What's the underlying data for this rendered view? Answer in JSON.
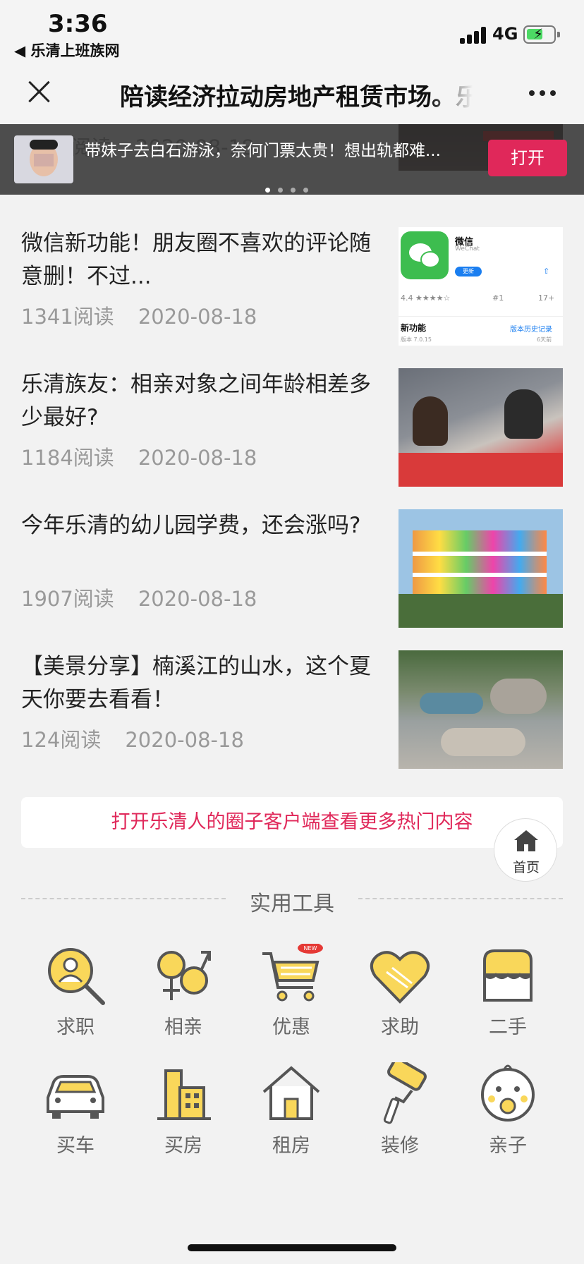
{
  "status_bar": {
    "time": "3:36",
    "back_app": "◀ 乐清上班族网",
    "network": "4G"
  },
  "nav": {
    "title": "陪读经济拉动房地产租赁市场。乐"
  },
  "banner": {
    "text": "带妹子去白石游泳，奈何门票太贵！想出轨都难...",
    "open_label": "打开",
    "partial_top_text": "毒！",
    "partial_read": "阅读",
    "partial_date": "2020-08-18"
  },
  "articles": [
    {
      "title": "微信新功能！朋友圈不喜欢的评论随意删！不过...",
      "reads": "1341阅读",
      "date": "2020-08-18",
      "thumb": {
        "app_name": "微信",
        "app_sub": "WeChat",
        "update": "更新",
        "rating": "4.4 ★★★★☆",
        "rank": "#1",
        "age": "17+",
        "new_features": "新功能",
        "history": "版本历史记录",
        "version": "版本 7.0.15",
        "days": "6天前"
      }
    },
    {
      "title": "乐清族友：相亲对象之间年龄相差多少最好?",
      "reads": "1184阅读",
      "date": "2020-08-18"
    },
    {
      "title": "今年乐清的幼儿园学费，还会涨吗?",
      "reads": "1907阅读",
      "date": "2020-08-18"
    },
    {
      "title": "【美景分享】楠溪江的山水，这个夏天你要去看看！",
      "reads": "124阅读",
      "date": "2020-08-18"
    }
  ],
  "promo": {
    "text": "打开乐清人的圈子客户端查看更多热门内容"
  },
  "home_button": {
    "label": "首页"
  },
  "tools": {
    "heading": "实用工具",
    "items": [
      {
        "label": "求职",
        "icon": "job-search-icon"
      },
      {
        "label": "相亲",
        "icon": "dating-icon"
      },
      {
        "label": "优惠",
        "icon": "cart-icon",
        "badge": "NEW"
      },
      {
        "label": "求助",
        "icon": "heart-hands-icon"
      },
      {
        "label": "二手",
        "icon": "secondhand-icon"
      },
      {
        "label": "买车",
        "icon": "car-icon"
      },
      {
        "label": "买房",
        "icon": "building-icon"
      },
      {
        "label": "租房",
        "icon": "house-icon"
      },
      {
        "label": "装修",
        "icon": "paint-roller-icon"
      },
      {
        "label": "亲子",
        "icon": "baby-icon"
      }
    ]
  },
  "colors": {
    "accent": "#e0285a",
    "tool_yellow": "#f9d75a",
    "tool_stroke": "#555555"
  }
}
